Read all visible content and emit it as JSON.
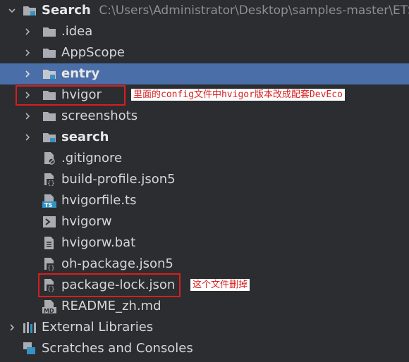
{
  "root": {
    "name": "Search",
    "path": "C:\\Users\\Administrator\\Desktop\\samples-master\\ETS"
  },
  "tree": [
    {
      "label": ".idea",
      "kind": "folder"
    },
    {
      "label": "AppScope",
      "kind": "folder"
    },
    {
      "label": "entry",
      "kind": "module",
      "selected": true
    },
    {
      "label": "hvigor",
      "kind": "folder"
    },
    {
      "label": "screenshots",
      "kind": "folder"
    },
    {
      "label": "search",
      "kind": "module"
    },
    {
      "label": ".gitignore",
      "kind": "file"
    },
    {
      "label": "build-profile.json5",
      "kind": "json"
    },
    {
      "label": "hvigorfile.ts",
      "kind": "ts"
    },
    {
      "label": "hvigorw",
      "kind": "shell"
    },
    {
      "label": "hvigorw.bat",
      "kind": "text"
    },
    {
      "label": "oh-package.json5",
      "kind": "json"
    },
    {
      "label": "package-lock.json",
      "kind": "json"
    },
    {
      "label": "README_zh.md",
      "kind": "md"
    }
  ],
  "bottom": [
    {
      "label": "External Libraries"
    },
    {
      "label": "Scratches and Consoles"
    }
  ],
  "annotations": {
    "hvigor_note": "里面的config文件中hvigor版本改成配套DevEco",
    "lock_note": "这个文件删掉"
  },
  "colors": {
    "background": "#2b2d30",
    "selection": "#4a6ea8",
    "annotation": "#d81e1e",
    "module_badge": "#3592c4"
  },
  "icons": {
    "folder": "folder-icon",
    "module": "module-folder-icon",
    "file": "ignore-file-icon",
    "json": "json-file-icon",
    "ts": "typescript-file-icon",
    "shell": "shell-script-icon",
    "text": "text-file-icon",
    "md": "markdown-file-icon"
  }
}
